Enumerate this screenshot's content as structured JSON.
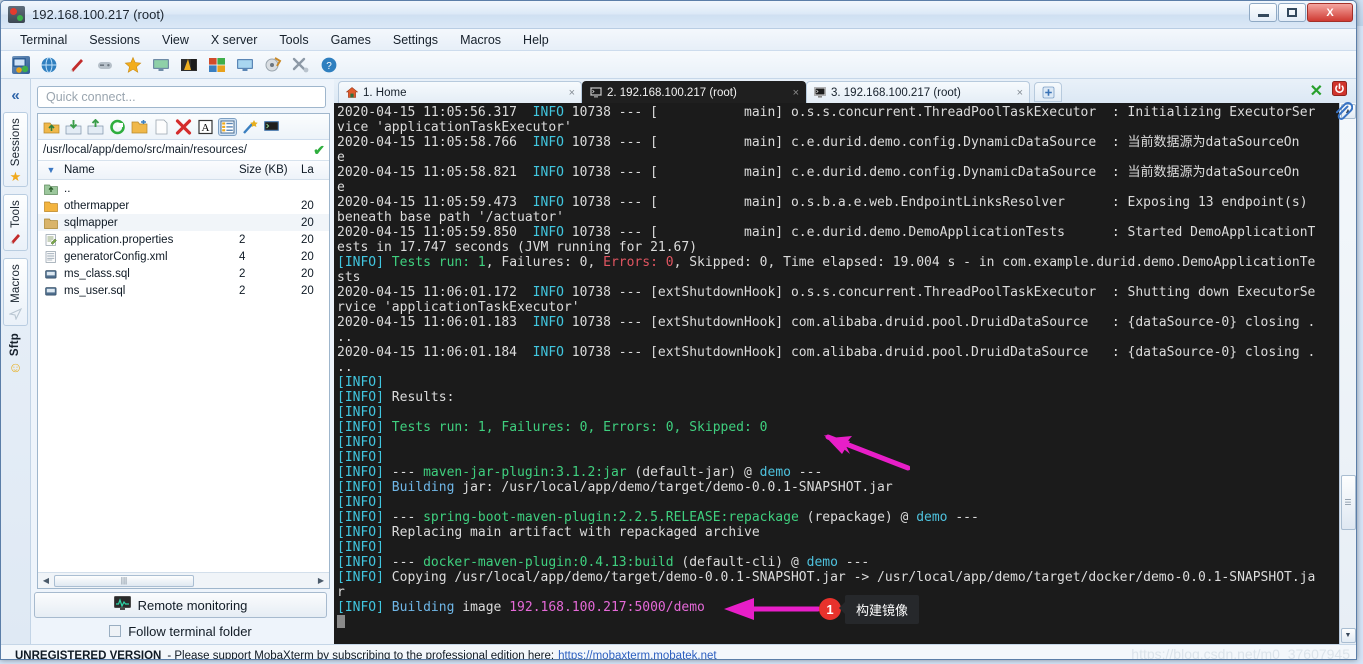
{
  "window": {
    "title": "192.168.100.217 (root)",
    "minimize_label": "Minimize",
    "maximize_label": "Maximize",
    "close_label": "X"
  },
  "background_tabs": [
    {
      "id": "bg1"
    },
    {
      "id": "bg2"
    },
    {
      "id": "bg3"
    },
    {
      "id": "bg4"
    },
    {
      "id": "bg5"
    },
    {
      "id": "bg6"
    },
    {
      "id": "bg7"
    }
  ],
  "menubar": {
    "items": [
      {
        "label": "Terminal"
      },
      {
        "label": "Sessions"
      },
      {
        "label": "View"
      },
      {
        "label": "X server"
      },
      {
        "label": "Tools"
      },
      {
        "label": "Games"
      },
      {
        "label": "Settings"
      },
      {
        "label": "Macros"
      },
      {
        "label": "Help"
      }
    ]
  },
  "toolbar": {
    "items": [
      {
        "name": "session-icon",
        "color": "#3b6fa8"
      },
      {
        "name": "globe-icon",
        "color": "#2f7fbf"
      },
      {
        "name": "tools-knife-icon",
        "color": "#c22b2b"
      },
      {
        "name": "games-icon",
        "color": "#9aa5ae"
      },
      {
        "name": "favorites-star-icon",
        "color": "#f2ad1d"
      },
      {
        "name": "display-icon",
        "color": "#4f8fc9"
      },
      {
        "name": "xserver-icon",
        "color": "#e8a11c"
      },
      {
        "name": "multiexec-icon",
        "color": "#d14b2a"
      },
      {
        "name": "remote-desktop-icon",
        "color": "#3f8fc0"
      },
      {
        "name": "packages-icon",
        "color": "#c98a2a"
      },
      {
        "name": "settings-tools-icon",
        "color": "#8d99a6"
      },
      {
        "name": "help-icon",
        "color": "#2f7fbf"
      }
    ]
  },
  "rail": {
    "collapse_label": "«",
    "groups": [
      {
        "label": "Sessions",
        "icon": "star-icon",
        "glyph": "★",
        "color": "#f0a91c"
      },
      {
        "label": "Tools",
        "icon": "knife-icon",
        "glyph": "🔪",
        "color": "#c22b2b"
      },
      {
        "label": "Macros",
        "icon": "paperplane-icon",
        "glyph": "➤",
        "color": "#b9c6d2"
      },
      {
        "label": "Sftp",
        "icon": "smiley-icon",
        "glyph": "☺",
        "color": "#e8b020"
      }
    ]
  },
  "sftp": {
    "quick_connect_placeholder": "Quick connect...",
    "path": "/usr/local/app/demo/src/main/resources/",
    "path_ok_glyph": "✔",
    "toolbar_icons": [
      {
        "name": "upload-folder-icon"
      },
      {
        "name": "download-icon"
      },
      {
        "name": "upload-icon"
      },
      {
        "name": "refresh-icon"
      },
      {
        "name": "new-folder-icon"
      },
      {
        "name": "new-file-icon"
      },
      {
        "name": "delete-icon"
      },
      {
        "name": "text-mode-icon"
      },
      {
        "name": "list-view-icon"
      },
      {
        "name": "magic-wand-icon"
      },
      {
        "name": "terminal-icon"
      }
    ],
    "columns": {
      "name": "Name",
      "size": "Size (KB)",
      "last": "La"
    },
    "files": [
      {
        "icon": "up-folder-icon",
        "name": "..",
        "size": "",
        "last": ""
      },
      {
        "icon": "folder-icon",
        "name": "othermapper",
        "size": "",
        "last": "20"
      },
      {
        "icon": "folder-icon",
        "name": "sqlmapper",
        "size": "",
        "last": "20"
      },
      {
        "icon": "properties-icon",
        "name": "application.properties",
        "size": "2",
        "last": "20"
      },
      {
        "icon": "xml-icon",
        "name": "generatorConfig.xml",
        "size": "4",
        "last": "20"
      },
      {
        "icon": "sql-icon",
        "name": "ms_class.sql",
        "size": "2",
        "last": "20"
      },
      {
        "icon": "sql-icon",
        "name": "ms_user.sql",
        "size": "2",
        "last": "20"
      }
    ],
    "remote_monitoring_label": "Remote monitoring",
    "follow_terminal_folder_label": "Follow terminal folder",
    "follow_terminal_folder_checked": false
  },
  "tabs": {
    "items": [
      {
        "label": "1. Home",
        "icon": "home-icon",
        "active": false,
        "close": "×"
      },
      {
        "label": "2. 192.168.100.217 (root)",
        "icon": "terminal-icon",
        "active": true,
        "close": "×"
      },
      {
        "label": "3. 192.168.100.217 (root)",
        "icon": "terminal-icon",
        "active": false,
        "close": "×"
      }
    ],
    "add_label": "+",
    "right_icons": [
      {
        "name": "xserver-x-icon",
        "glyph": "✕",
        "color": "#28a02c"
      },
      {
        "name": "power-icon",
        "glyph": "⏻",
        "color": "#d0342c"
      },
      {
        "name": "paperclip-icon",
        "glyph": "📎",
        "color": "#3a74c4"
      }
    ]
  },
  "terminal": {
    "lines": [
      [
        {
          "t": "2020-04-15 11:05:56.317  ",
          "c": "plain"
        },
        {
          "t": "INFO",
          "c": "info"
        },
        {
          "t": " 10738 --- [           main] o.s.s.concurrent.ThreadPoolTaskExecutor  : Initializing ExecutorSer",
          "c": "plain"
        }
      ],
      [
        {
          "t": "vice 'applicationTaskExecutor'",
          "c": "plain"
        }
      ],
      [
        {
          "t": "2020-04-15 11:05:58.766  ",
          "c": "plain"
        },
        {
          "t": "INFO",
          "c": "info"
        },
        {
          "t": " 10738 --- [           main] c.e.durid.demo.config.DynamicDataSource  : 当前数据源为dataSourceOn",
          "c": "plain"
        }
      ],
      [
        {
          "t": "e",
          "c": "plain"
        }
      ],
      [
        {
          "t": "2020-04-15 11:05:58.821  ",
          "c": "plain"
        },
        {
          "t": "INFO",
          "c": "info"
        },
        {
          "t": " 10738 --- [           main] c.e.durid.demo.config.DynamicDataSource  : 当前数据源为dataSourceOn",
          "c": "plain"
        }
      ],
      [
        {
          "t": "e",
          "c": "plain"
        }
      ],
      [
        {
          "t": "2020-04-15 11:05:59.473  ",
          "c": "plain"
        },
        {
          "t": "INFO",
          "c": "info"
        },
        {
          "t": " 10738 --- [           main] o.s.b.a.e.web.EndpointLinksResolver      : Exposing 13 endpoint(s) ",
          "c": "plain"
        }
      ],
      [
        {
          "t": "beneath base path '/actuator'",
          "c": "plain"
        }
      ],
      [
        {
          "t": "2020-04-15 11:05:59.850  ",
          "c": "plain"
        },
        {
          "t": "INFO",
          "c": "info"
        },
        {
          "t": " 10738 --- [           main] c.e.durid.demo.DemoApplicationTests      : Started DemoApplicationT",
          "c": "plain"
        }
      ],
      [
        {
          "t": "ests in 17.747 seconds (JVM running for 21.67)",
          "c": "plain"
        }
      ],
      [
        {
          "t": "[INFO]",
          "c": "info"
        },
        {
          "t": " ",
          "c": "plain"
        },
        {
          "t": "Tests run: 1",
          "c": "green"
        },
        {
          "t": ", Failures: 0, ",
          "c": "plain"
        },
        {
          "t": "Errors: 0",
          "c": "red"
        },
        {
          "t": ", Skipped: 0, Time elapsed: 19.004 s - in com.example.durid.demo.DemoApplicationTe",
          "c": "plain"
        }
      ],
      [
        {
          "t": "sts",
          "c": "plain"
        }
      ],
      [
        {
          "t": "2020-04-15 11:06:01.172  ",
          "c": "plain"
        },
        {
          "t": "INFO",
          "c": "info"
        },
        {
          "t": " 10738 --- [extShutdownHook] o.s.s.concurrent.ThreadPoolTaskExecutor  : Shutting down ExecutorSe",
          "c": "plain"
        }
      ],
      [
        {
          "t": "rvice 'applicationTaskExecutor'",
          "c": "plain"
        }
      ],
      [
        {
          "t": "2020-04-15 11:06:01.183  ",
          "c": "plain"
        },
        {
          "t": "INFO",
          "c": "info"
        },
        {
          "t": " 10738 --- [extShutdownHook] com.alibaba.druid.pool.DruidDataSource   : {dataSource-0} closing .",
          "c": "plain"
        }
      ],
      [
        {
          "t": "..",
          "c": "plain"
        }
      ],
      [
        {
          "t": "2020-04-15 11:06:01.184  ",
          "c": "plain"
        },
        {
          "t": "INFO",
          "c": "info"
        },
        {
          "t": " 10738 --- [extShutdownHook] com.alibaba.druid.pool.DruidDataSource   : {dataSource-0} closing .",
          "c": "plain"
        }
      ],
      [
        {
          "t": "..",
          "c": "plain"
        }
      ],
      [
        {
          "t": "[INFO]",
          "c": "info"
        }
      ],
      [
        {
          "t": "[INFO]",
          "c": "info"
        },
        {
          "t": " Results:",
          "c": "plain"
        }
      ],
      [
        {
          "t": "[INFO]",
          "c": "info"
        }
      ],
      [
        {
          "t": "[INFO]",
          "c": "info"
        },
        {
          "t": " ",
          "c": "plain"
        },
        {
          "t": "Tests run: 1, Failures: 0, Errors: 0, Skipped: 0",
          "c": "green"
        }
      ],
      [
        {
          "t": "[INFO]",
          "c": "info"
        }
      ],
      [
        {
          "t": "[INFO]",
          "c": "info"
        }
      ],
      [
        {
          "t": "[INFO]",
          "c": "info"
        },
        {
          "t": " --- ",
          "c": "plain"
        },
        {
          "t": "maven-jar-plugin:3.1.2:jar",
          "c": "green"
        },
        {
          "t": " (default-jar) @ ",
          "c": "plain"
        },
        {
          "t": "demo",
          "c": "cyan2"
        },
        {
          "t": " ---",
          "c": "plain"
        }
      ],
      [
        {
          "t": "[INFO]",
          "c": "info"
        },
        {
          "t": " ",
          "c": "plain"
        },
        {
          "t": "Building",
          "c": "blue"
        },
        {
          "t": " jar: /usr/local/app/demo/target/demo-0.0.1-SNAPSHOT.jar",
          "c": "plain"
        }
      ],
      [
        {
          "t": "[INFO]",
          "c": "info"
        }
      ],
      [
        {
          "t": "[INFO]",
          "c": "info"
        },
        {
          "t": " --- ",
          "c": "plain"
        },
        {
          "t": "spring-boot-maven-plugin:2.2.5.RELEASE:repackage",
          "c": "green"
        },
        {
          "t": " (repackage) @ ",
          "c": "plain"
        },
        {
          "t": "demo",
          "c": "cyan2"
        },
        {
          "t": " ---",
          "c": "plain"
        }
      ],
      [
        {
          "t": "[INFO]",
          "c": "info"
        },
        {
          "t": " Replacing main artifact with repackaged archive",
          "c": "plain"
        }
      ],
      [
        {
          "t": "[INFO]",
          "c": "info"
        }
      ],
      [
        {
          "t": "[INFO]",
          "c": "info"
        },
        {
          "t": " --- ",
          "c": "plain"
        },
        {
          "t": "docker-maven-plugin:0.4.13:build",
          "c": "green"
        },
        {
          "t": " (default-cli) @ ",
          "c": "plain"
        },
        {
          "t": "demo",
          "c": "cyan2"
        },
        {
          "t": " ---",
          "c": "plain"
        }
      ],
      [
        {
          "t": "[INFO]",
          "c": "info"
        },
        {
          "t": " Copying /usr/local/app/demo/target/demo-0.0.1-SNAPSHOT.jar -> /usr/local/app/demo/target/docker/demo-0.0.1-SNAPSHOT.ja",
          "c": "plain"
        }
      ],
      [
        {
          "t": "r",
          "c": "plain"
        }
      ],
      [
        {
          "t": "[INFO]",
          "c": "info"
        },
        {
          "t": " ",
          "c": "plain"
        },
        {
          "t": "Building",
          "c": "blue"
        },
        {
          "t": " image ",
          "c": "plain"
        },
        {
          "t": "192.168.100.217:5000/demo",
          "c": "magenta"
        }
      ]
    ]
  },
  "annotations": {
    "badge_number": "1",
    "callout_text": "构建镜像",
    "arrow_color": "#e81ec8",
    "badge_color": "#e8322c"
  },
  "statusbar": {
    "unregistered": "UNREGISTERED VERSION",
    "message": "- Please support MobaXterm by subscribing to the professional edition here:",
    "link": "https://mobaxterm.mobatek.net"
  },
  "watermark": "https://blog.csdn.net/m0_37607945"
}
